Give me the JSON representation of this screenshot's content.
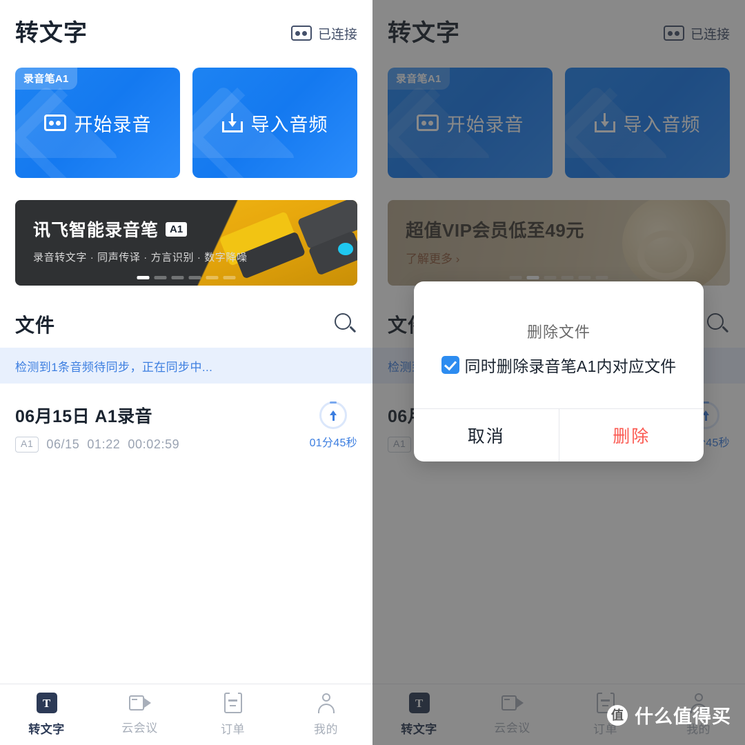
{
  "app": {
    "title": "转文字",
    "connection_label": "已连接",
    "connection_icon": "cassette-icon"
  },
  "actions": [
    {
      "badge": "录音笔A1",
      "label": "开始录音",
      "icon": "recorder-icon",
      "color": "#1479f0"
    },
    {
      "badge": "",
      "label": "导入音频",
      "icon": "import-audio-icon",
      "color": "#1479f0"
    }
  ],
  "promo_left": {
    "title": "讯飞智能录音笔",
    "chip": "A1",
    "subtitle": "录音转文字 · 同声传译 · 方言识别 · 数字降噪",
    "dots_total": 6,
    "dots_active_index": 0
  },
  "promo_right": {
    "title": "超值VIP会员低至49元",
    "more_label": "了解更多 ›"
  },
  "files": {
    "section_title": "文件",
    "search_icon": "search-icon",
    "sync_notice": "检测到1条音频待同步，正在同步中...",
    "items": [
      {
        "name": "06月15日 A1录音",
        "device_tag": "A1",
        "date": "06/15",
        "time": "01:22",
        "duration": "00:02:59",
        "upload_icon": "upload-arrow-icon",
        "remaining": "01分45秒"
      }
    ]
  },
  "tabbar": {
    "items": [
      {
        "label": "转文字",
        "icon": "text-convert-icon",
        "active": true
      },
      {
        "label": "云会议",
        "icon": "video-camera-icon",
        "active": false
      },
      {
        "label": "订单",
        "icon": "order-list-icon",
        "active": false
      },
      {
        "label": "我的",
        "icon": "user-profile-icon",
        "active": false
      }
    ]
  },
  "dialog": {
    "title": "删除文件",
    "checkbox_label": "同时删除录音笔A1内对应文件",
    "checkbox_checked": true,
    "cancel_label": "取消",
    "confirm_label": "删除",
    "confirm_color": "#fb5a52"
  },
  "watermark": {
    "logo_char": "值",
    "text": "什么值得买"
  }
}
